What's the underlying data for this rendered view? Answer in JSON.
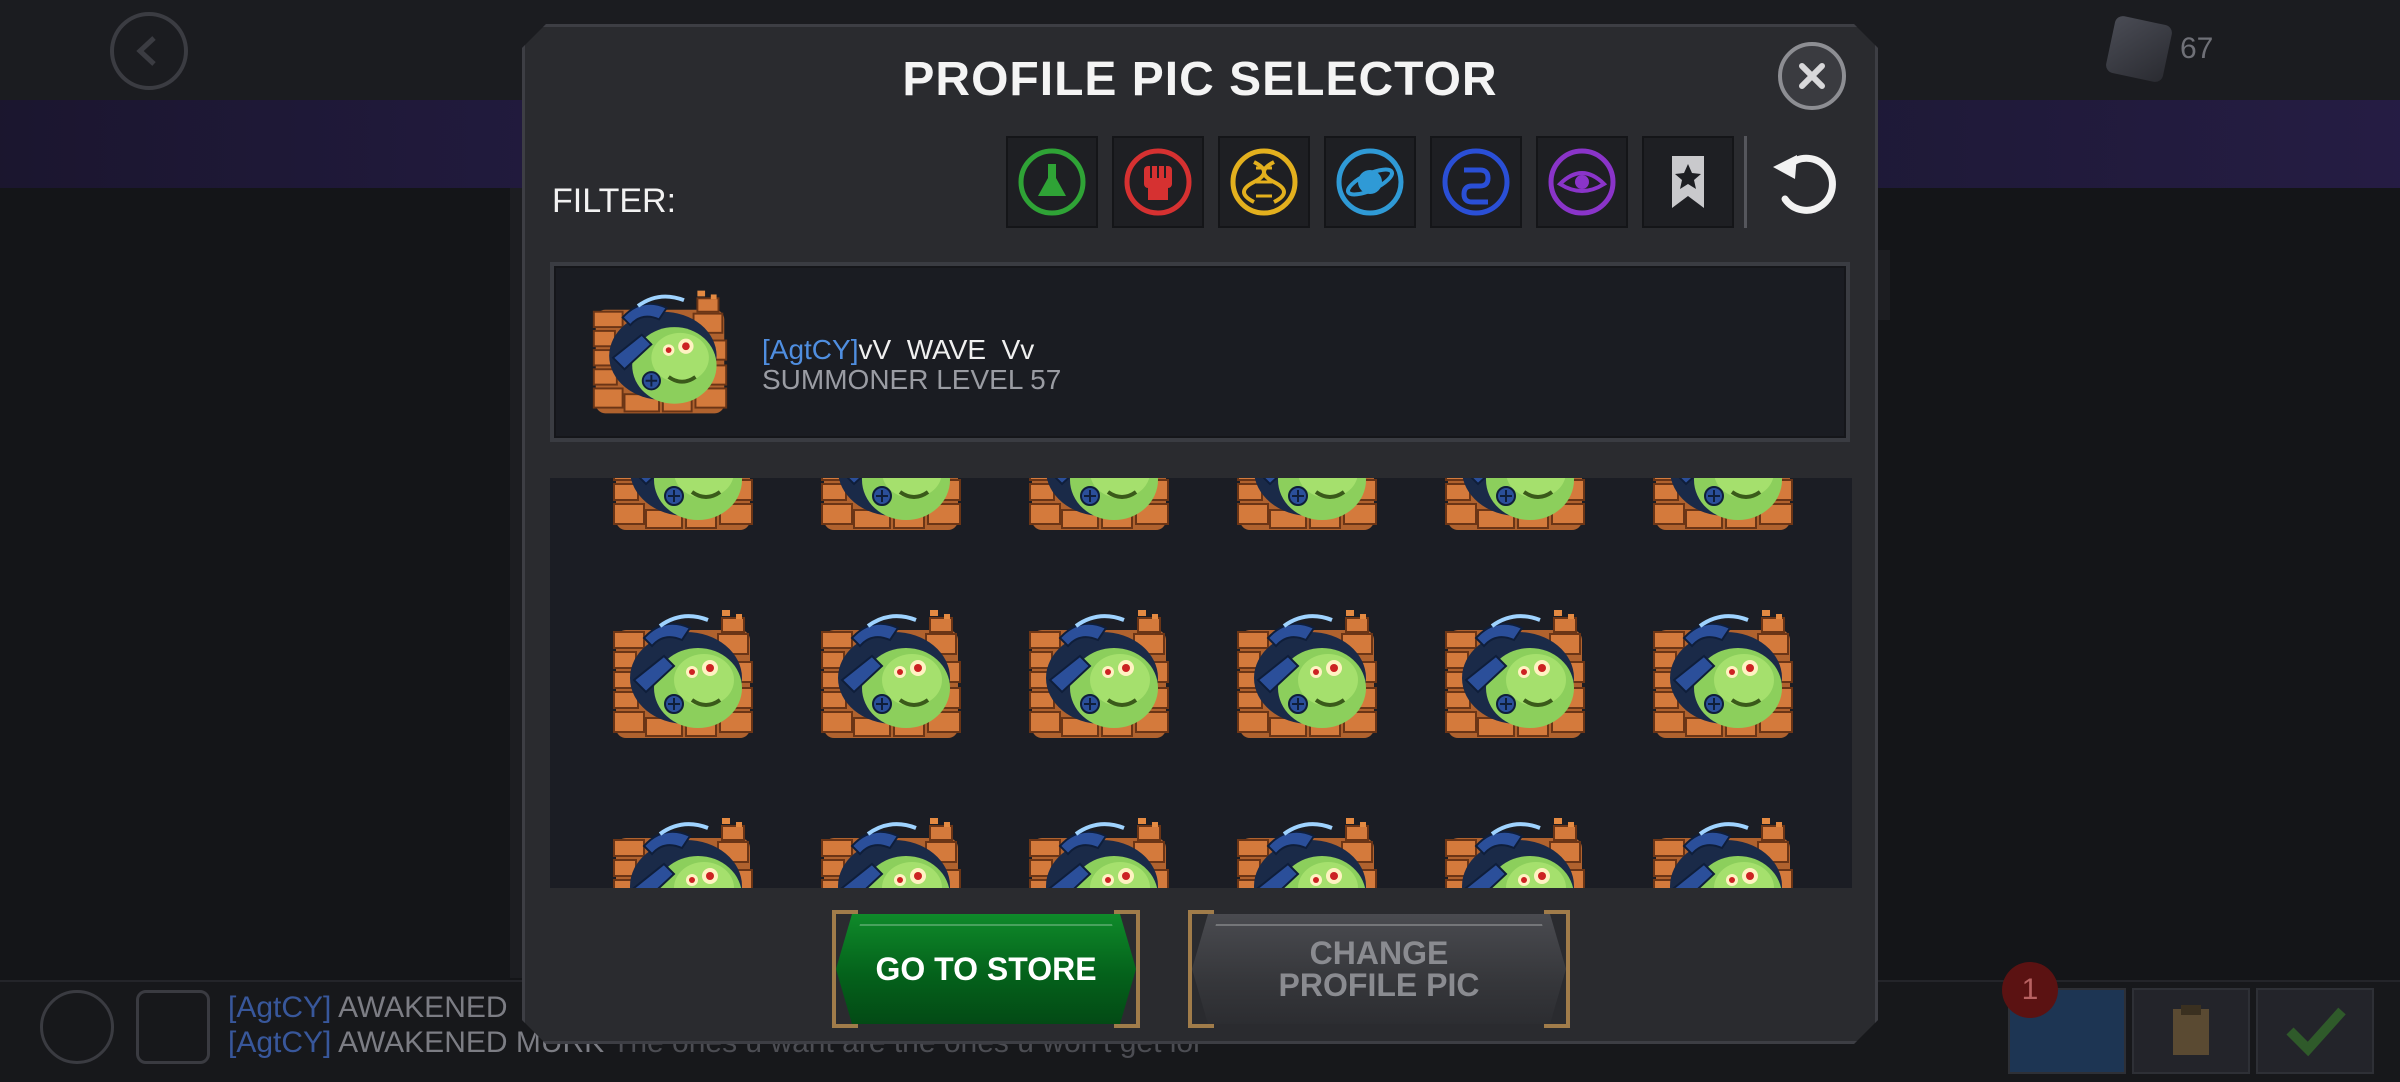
{
  "background": {
    "currency_value": "67",
    "chat": [
      {
        "tag": "[AgtCY]",
        "text": "AWAKENED",
        "message": ""
      },
      {
        "tag": "[AgtCY]",
        "text": "AWAKENED MURK",
        "message": "The ones u want are the ones u won't get lol"
      }
    ],
    "notification_count": "1"
  },
  "modal": {
    "title": "PROFILE PIC SELECTOR",
    "filter_label": "FILTER:",
    "filters": [
      {
        "name": "science",
        "color": "#2fa336"
      },
      {
        "name": "skill",
        "color": "#d63131"
      },
      {
        "name": "mutant",
        "color": "#e3b01e"
      },
      {
        "name": "cosmic",
        "color": "#2f9ad6"
      },
      {
        "name": "tech",
        "color": "#2a4fd6"
      },
      {
        "name": "mystic",
        "color": "#8a34c9"
      },
      {
        "name": "favorites",
        "color": "#c9c9cc"
      }
    ],
    "profile": {
      "tag": "[AgtCY]",
      "name": "vV  WAVE  Vv",
      "level": "SUMMONER LEVEL 57"
    },
    "grid_rows": 3,
    "grid_cols": 6,
    "buttons": {
      "store": "GO TO STORE",
      "change": "CHANGE PROFILE PIC"
    }
  }
}
